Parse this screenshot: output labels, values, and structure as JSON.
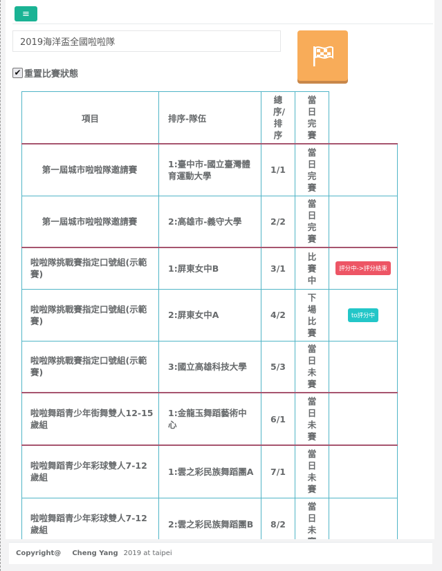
{
  "menu_icon": "hamburger-icon",
  "title_value": "2019海洋盃全國啦啦隊",
  "flag_icon": "checkered-flag-icon",
  "reset_label": "重置比賽狀態",
  "reset_checked": true,
  "table": {
    "headers": [
      "項目",
      "排序-隊伍",
      "總序/排序",
      "當日完賽"
    ],
    "rows": [
      {
        "item": "第一屆城市啦啦隊邀請賽",
        "team": "1:臺中市-國立臺灣體育運動大學",
        "order": "1/1",
        "status": "當日完賽",
        "action": ""
      },
      {
        "item": "第一屆城市啦啦隊邀請賽",
        "team": "2:高雄市-義守大學",
        "order": "2/2",
        "status": "當日完賽",
        "action": ""
      },
      {
        "item": "啦啦隊挑戰賽指定口號組(示範賽)",
        "team": "1:屏東女中B",
        "order": "3/1",
        "status": "比賽中",
        "action": "評分中->評分結束"
      },
      {
        "item": "啦啦隊挑戰賽指定口號組(示範賽)",
        "team": "2:屏東女中A",
        "order": "4/2",
        "status": "下場比賽",
        "action": "to評分中"
      },
      {
        "item": "啦啦隊挑戰賽指定口號組(示範賽)",
        "team": "3:國立高雄科技大學",
        "order": "5/3",
        "status": "當日未賽",
        "action": ""
      },
      {
        "item": "啦啦舞蹈青少年街舞雙人12-15歲組",
        "team": "1:金龍玉舞蹈藝術中心",
        "order": "6/1",
        "status": "當日未賽",
        "action": ""
      },
      {
        "item": "啦啦舞蹈青少年彩球雙人7-12歲組",
        "team": "1:雲之彩民族舞蹈團A",
        "order": "7/1",
        "status": "當日未賽",
        "action": ""
      },
      {
        "item": "啦啦舞蹈青少年彩球雙人7-12歲組",
        "team": "2:雲之彩民族舞蹈團B",
        "order": "8/2",
        "status": "當日未賽",
        "action": ""
      }
    ]
  },
  "footer": {
    "copyright": "Copyright@",
    "author": "Cheng Yang",
    "note": "2019 at taipei"
  },
  "colors": {
    "accent": "#1ab394",
    "flag_button": "#f8ac59",
    "table_border": "#4fb4c6",
    "group_divider": "#a6546e",
    "badge_red": "#ed5565",
    "badge_cyan": "#23c6c8"
  }
}
